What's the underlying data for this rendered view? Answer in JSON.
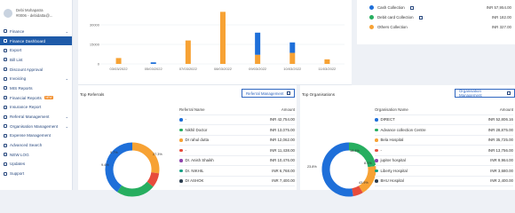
{
  "user": {
    "name": "Debi Mohapatra",
    "id": "#0006 - debidatta@..."
  },
  "sidebar": {
    "items": [
      {
        "label": "Finance",
        "chevron": true
      },
      {
        "label": "Finance Dashboard",
        "active": true
      },
      {
        "label": "Export"
      },
      {
        "label": "Bill List"
      },
      {
        "label": "Discount Approval"
      },
      {
        "label": "Invoicing",
        "chevron": true
      },
      {
        "label": "MIS Reports"
      },
      {
        "label": "Financial Reports",
        "badge": "NEW"
      },
      {
        "label": "Insurance Report"
      },
      {
        "label": "Referral Management",
        "chevron": true
      },
      {
        "label": "Organisation Management",
        "chevron": true
      },
      {
        "label": "Expense Management"
      },
      {
        "label": "Advanced Search"
      },
      {
        "label": "NEW LOG"
      },
      {
        "label": "Updates"
      },
      {
        "label": "Support"
      }
    ]
  },
  "top_chart": {
    "chart_data": {
      "type": "bar",
      "stacked": true,
      "categories": [
        "03/03/2022",
        "05/03/2022",
        "07/03/2022",
        "08/03/2022",
        "09/03/2022",
        "10/03/2022",
        "11/03/2022"
      ],
      "series": [
        {
          "name": "Cash Collection",
          "color": "#1e6fd9",
          "values": [
            0,
            1200,
            0,
            0,
            17000,
            8000,
            0
          ]
        },
        {
          "name": "Others Collection",
          "color": "#f7a234",
          "values": [
            4500,
            0,
            18000,
            40000,
            7000,
            8500,
            3500
          ]
        }
      ],
      "ylim": [
        0,
        45000
      ],
      "yticks": [
        "30000",
        "15000",
        "0"
      ]
    }
  },
  "legend": {
    "items": [
      {
        "label": "Cash Collection",
        "color": "#1e6fd9",
        "amount": "INR 57,954.00"
      },
      {
        "label": "Debit card Collection",
        "color": "#27ae60",
        "amount": "INR 182.00"
      },
      {
        "label": "Others Collection",
        "color": "#f7a234",
        "amount": "INR 327.00"
      }
    ]
  },
  "referrals": {
    "title": "Top Referrals",
    "button": "Referral Management",
    "col_name": "Referral Name",
    "col_amount": "Amount",
    "rows": [
      {
        "name": "-",
        "amount": "INR 42,754.00",
        "color": "#1e6fd9"
      },
      {
        "name": "Nikhil Doctor",
        "amount": "INR 13,075.00",
        "color": "#27ae60"
      },
      {
        "name": "Dr rahul dutta",
        "amount": "INR 12,062.00",
        "color": "#f7a234"
      },
      {
        "name": "-",
        "amount": "INR 11,438.00",
        "color": "#e74c3c"
      },
      {
        "name": "Dr. Anish Shaikh",
        "amount": "INR 10,476.00",
        "color": "#8e44ad"
      },
      {
        "name": "Dr. NIKHIL",
        "amount": "INR 6,768.00",
        "color": "#16a085"
      },
      {
        "name": "Dr ASHOK",
        "amount": "INR 7,400.00",
        "color": "#2c3e50"
      }
    ],
    "donut": {
      "values": [
        27.3,
        8.7,
        23.4,
        40.6
      ],
      "colors": [
        "#f7a234",
        "#e74c3c",
        "#27ae60",
        "#1e6fd9"
      ],
      "labels": [
        "9.7%",
        "9.4%",
        "27.3%"
      ]
    }
  },
  "organisations": {
    "title": "Top Organisations",
    "button": "Organisation Management",
    "col_name": "Organisation Name",
    "col_amount": "Amount",
    "rows": [
      {
        "name": "DIRECT",
        "amount": "INR 52,806.16",
        "color": "#1e6fd9"
      },
      {
        "name": "Advance collection Centre",
        "amount": "INR 28,875.00",
        "color": "#27ae60"
      },
      {
        "name": "Bela Hospital",
        "amount": "INR 35,725.00",
        "color": "#f7a234"
      },
      {
        "name": "-",
        "amount": "INR 13,756.00",
        "color": "#e74c3c"
      },
      {
        "name": "jupiter hospital",
        "amount": "INR 9,964.00",
        "color": "#8e44ad"
      },
      {
        "name": "Liberty Hospital",
        "amount": "INR 3,680.00",
        "color": "#16a085"
      },
      {
        "name": "BHU Hospital",
        "amount": "INR 2,400.00",
        "color": "#2c3e50"
      }
    ],
    "donut": {
      "values": [
        23.0,
        18.4,
        6.1,
        52.5
      ],
      "colors": [
        "#27ae60",
        "#f7a234",
        "#e74c3c",
        "#1e6fd9"
      ],
      "labels": [
        "23.8%",
        "18.4%",
        "8.1%",
        "43.9%"
      ]
    }
  }
}
